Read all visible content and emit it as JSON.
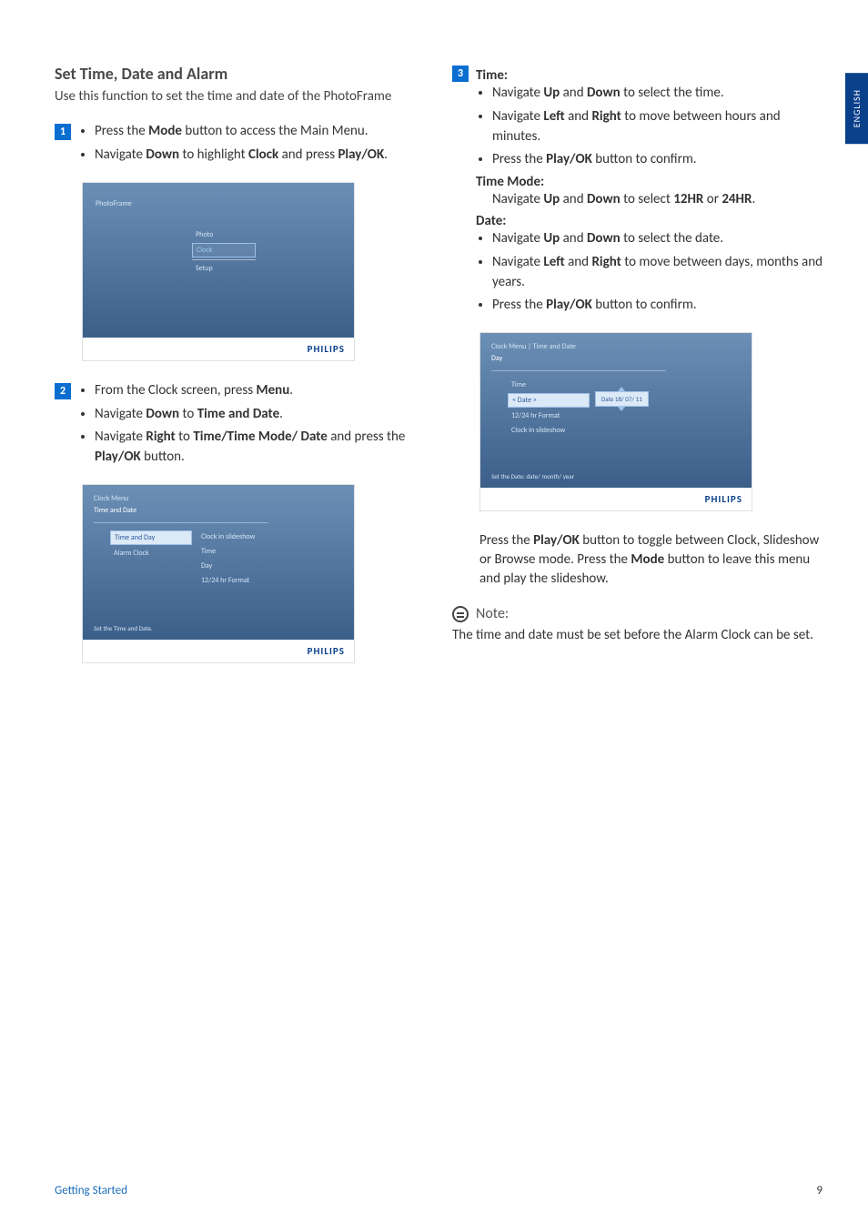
{
  "sideTab": "ENGLISH",
  "title": "Set Time, Date and Alarm",
  "intro": "Use this function to set the time and date of the PhotoFrame",
  "steps": {
    "s1": {
      "num": "1",
      "b1_pre": "Press the ",
      "b1_bold": "Mode",
      "b1_post": " button to access the Main Menu.",
      "b2_pre": "Navigate ",
      "b2_bold1": "Down",
      "b2_mid": " to highlight ",
      "b2_bold2": "Clock",
      "b2_post": " and press ",
      "b2_bold3": "Play/OK",
      "b2_end": "."
    },
    "s2": {
      "num": "2",
      "b1_pre": "From the Clock screen, press ",
      "b1_bold": "Menu",
      "b1_end": ".",
      "b2_pre": "Navigate ",
      "b2_bold1": "Down",
      "b2_mid": " to ",
      "b2_bold2": "Time and Date",
      "b2_end": ".",
      "b3_pre": "Navigate ",
      "b3_bold1": "Right",
      "b3_mid": " to ",
      "b3_bold2": "Time/Time Mode/ Date",
      "b3_post": " and press the ",
      "b3_bold3": "Play/OK",
      "b3_end": " button."
    },
    "s3": {
      "num": "3",
      "time_heading": "Time:",
      "t1_pre": "Navigate ",
      "t1_b1": "Up",
      "t1_mid": " and ",
      "t1_b2": "Down",
      "t1_post": " to select the time.",
      "t2_pre": "Navigate ",
      "t2_b1": "Left",
      "t2_mid": " and ",
      "t2_b2": "Right",
      "t2_post": " to move between hours and minutes.",
      "t3_pre": "Press the ",
      "t3_b1": "Play/OK",
      "t3_post": " button to confirm.",
      "mode_heading": "Time Mode:",
      "mode_pre": "Navigate ",
      "mode_b1": "Up",
      "mode_mid": " and ",
      "mode_b2": "Down",
      "mode_mid2": " to select ",
      "mode_b3": "12HR",
      "mode_or": " or ",
      "mode_b4": "24HR",
      "mode_end": ".",
      "date_heading": "Date:",
      "d1_pre": "Navigate ",
      "d1_b1": "Up",
      "d1_mid": " and ",
      "d1_b2": "Down",
      "d1_post": " to select the date.",
      "d2_pre": "Navigate ",
      "d2_b1": "Left",
      "d2_mid": " and ",
      "d2_b2": "Right",
      "d2_post": " to move between days, months and years.",
      "d3_pre": "Press the ",
      "d3_b1": "Play/OK",
      "d3_post": " button to confirm."
    }
  },
  "mock1": {
    "pf": "PhotoFrame",
    "m1": "Photo",
    "m2": "Clock",
    "m3": "Setup",
    "brand": "PHILIPS"
  },
  "mock2": {
    "crumb": "Clock Menu",
    "sel": "Time and Date",
    "l1": "Time and Day",
    "l2": "Alarm Clock",
    "r1": "Clock in slideshow",
    "r2": "Time",
    "r3": "Day",
    "r4": "12/24 hr Format",
    "hint": "Set the Time and Date.",
    "brand": "PHILIPS"
  },
  "mock3": {
    "crumb": "Clock Menu | Time and Date",
    "sel": "Day",
    "l1": "Time",
    "l2": "< Date >",
    "l3": "12/24 hr Format",
    "l4": "Clock in slideshow",
    "date": "Date 18/ 07/ 11",
    "hint": "Set the Date: date/ month/ year",
    "brand": "PHILIPS"
  },
  "after": {
    "p1_pre": "Press the ",
    "p1_b": "Play/OK",
    "p1_post": " button to toggle between Clock, Slideshow or Browse mode. Press the ",
    "p1_b2": "Mode",
    "p1_post2": " button to leave this menu and play the slideshow."
  },
  "note": {
    "label": "Note:",
    "text": "The time and date must be set before the Alarm Clock can be set."
  },
  "footer": {
    "left": "Getting Started",
    "right": "9"
  }
}
